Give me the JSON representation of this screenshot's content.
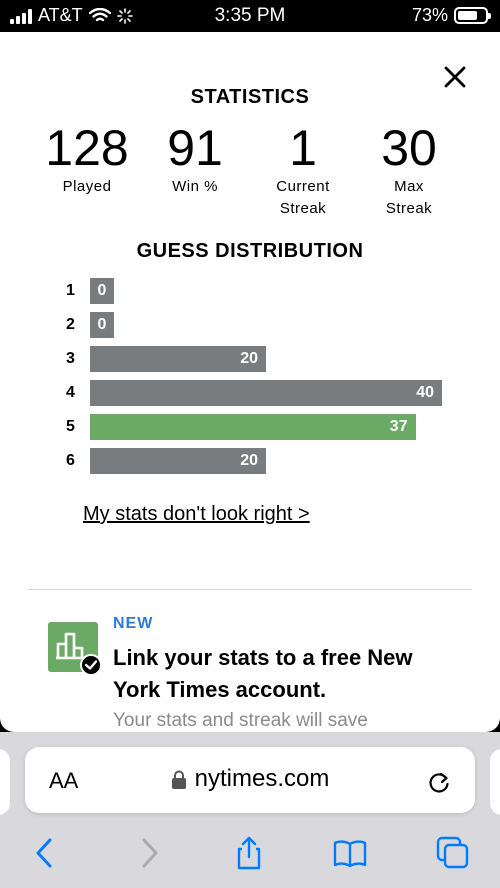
{
  "status_bar": {
    "carrier": "AT&T",
    "time": "3:35 PM",
    "battery": "73%",
    "battery_level": 0.73
  },
  "modal": {
    "title": "STATISTICS",
    "stats": [
      {
        "value": "128",
        "label": [
          "Played"
        ]
      },
      {
        "value": "91",
        "label": [
          "Win %"
        ]
      },
      {
        "value": "1",
        "label": [
          "Current",
          "Streak"
        ]
      },
      {
        "value": "30",
        "label": [
          "Max",
          "Streak"
        ]
      }
    ],
    "distribution_title": "GUESS DISTRIBUTION",
    "distribution": [
      {
        "guess": "1",
        "count": 0,
        "highlight": false
      },
      {
        "guess": "2",
        "count": 0,
        "highlight": false
      },
      {
        "guess": "3",
        "count": 20,
        "highlight": false
      },
      {
        "guess": "4",
        "count": 40,
        "highlight": false
      },
      {
        "guess": "5",
        "count": 37,
        "highlight": true
      },
      {
        "guess": "6",
        "count": 20,
        "highlight": false
      }
    ],
    "stats_link": "My stats don't look right >"
  },
  "promo": {
    "badge": "NEW",
    "title": "Link your stats to a free New York Times account.",
    "body": "Your stats and streak will save"
  },
  "browser": {
    "text_size_label": "AA",
    "url": "nytimes.com"
  },
  "colors": {
    "bar": "#787c7e",
    "bar_correct": "#6aaa64",
    "badge": "#2b7bd8",
    "link_blue": "#007aff"
  },
  "icons": {
    "close": "close-icon",
    "lock": "lock-icon",
    "reload": "reload-icon",
    "back": "chevron-left-icon",
    "forward": "chevron-right-icon",
    "share": "share-icon",
    "bookmarks": "book-icon",
    "tabs": "tabs-icon",
    "promo": "bar-chart-icon",
    "check": "check-badge-icon"
  }
}
